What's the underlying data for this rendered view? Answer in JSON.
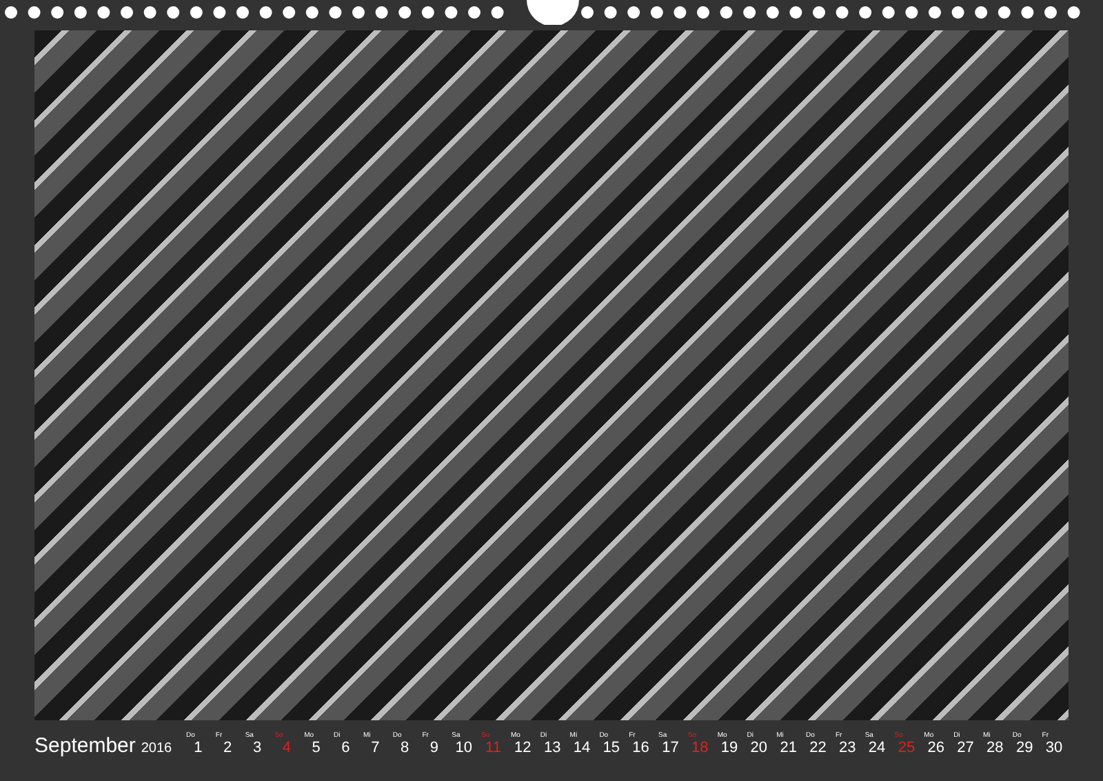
{
  "calendar": {
    "month": "September",
    "year": "2016"
  },
  "photo": {
    "kind": "photo"
  },
  "days": [
    {
      "weekday": "Do",
      "day": "1",
      "sunday": false
    },
    {
      "weekday": "Fr",
      "day": "2",
      "sunday": false
    },
    {
      "weekday": "Sa",
      "day": "3",
      "sunday": false
    },
    {
      "weekday": "So",
      "day": "4",
      "sunday": true
    },
    {
      "weekday": "Mo",
      "day": "5",
      "sunday": false
    },
    {
      "weekday": "Di",
      "day": "6",
      "sunday": false
    },
    {
      "weekday": "Mi",
      "day": "7",
      "sunday": false
    },
    {
      "weekday": "Do",
      "day": "8",
      "sunday": false
    },
    {
      "weekday": "Fr",
      "day": "9",
      "sunday": false
    },
    {
      "weekday": "Sa",
      "day": "10",
      "sunday": false
    },
    {
      "weekday": "So",
      "day": "11",
      "sunday": true
    },
    {
      "weekday": "Mo",
      "day": "12",
      "sunday": false
    },
    {
      "weekday": "Di",
      "day": "13",
      "sunday": false
    },
    {
      "weekday": "Mi",
      "day": "14",
      "sunday": false
    },
    {
      "weekday": "Do",
      "day": "15",
      "sunday": false
    },
    {
      "weekday": "Fr",
      "day": "16",
      "sunday": false
    },
    {
      "weekday": "Sa",
      "day": "17",
      "sunday": false
    },
    {
      "weekday": "So",
      "day": "18",
      "sunday": true
    },
    {
      "weekday": "Mo",
      "day": "19",
      "sunday": false
    },
    {
      "weekday": "Di",
      "day": "20",
      "sunday": false
    },
    {
      "weekday": "Mi",
      "day": "21",
      "sunday": false
    },
    {
      "weekday": "Do",
      "day": "22",
      "sunday": false
    },
    {
      "weekday": "Fr",
      "day": "23",
      "sunday": false
    },
    {
      "weekday": "Sa",
      "day": "24",
      "sunday": false
    },
    {
      "weekday": "So",
      "day": "25",
      "sunday": true
    },
    {
      "weekday": "Mo",
      "day": "26",
      "sunday": false
    },
    {
      "weekday": "Di",
      "day": "27",
      "sunday": false
    },
    {
      "weekday": "Mi",
      "day": "28",
      "sunday": false
    },
    {
      "weekday": "Do",
      "day": "29",
      "sunday": false
    },
    {
      "weekday": "Fr",
      "day": "30",
      "sunday": false
    }
  ]
}
